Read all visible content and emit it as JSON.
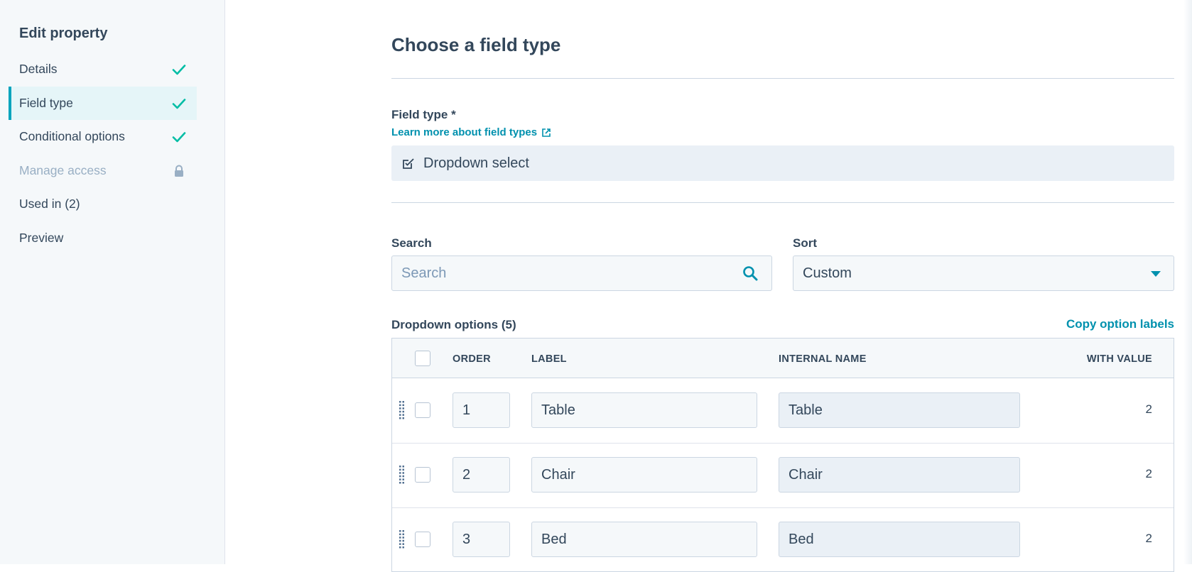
{
  "sidebar": {
    "title": "Edit property",
    "items": [
      {
        "label": "Details",
        "status_icon": "check-icon"
      },
      {
        "label": "Field type",
        "status_icon": "check-icon",
        "active": true
      },
      {
        "label": "Conditional options",
        "status_icon": "check-icon"
      },
      {
        "label": "Manage access",
        "status_icon": "lock-icon",
        "disabled": true
      },
      {
        "label": "Used in (2)"
      },
      {
        "label": "Preview"
      }
    ]
  },
  "main": {
    "title": "Choose a field type",
    "field_type": {
      "label": "Field type *",
      "learn_more_link": "Learn more about field types",
      "selected": "Dropdown select",
      "selected_icon": "checkbox-edit-icon"
    },
    "search": {
      "label": "Search",
      "placeholder": "Search"
    },
    "sort": {
      "label": "Sort",
      "value": "Custom"
    },
    "options": {
      "title": "Dropdown options (5)",
      "copy_link": "Copy option labels",
      "columns": {
        "order": "ORDER",
        "label": "LABEL",
        "internal_name": "INTERNAL NAME",
        "with_value": "WITH VALUE"
      },
      "rows": [
        {
          "order": "1",
          "label": "Table",
          "internal_name": "Table",
          "with_value": "2"
        },
        {
          "order": "2",
          "label": "Chair",
          "internal_name": "Chair",
          "with_value": "2"
        },
        {
          "order": "3",
          "label": "Bed",
          "internal_name": "Bed",
          "with_value": "2"
        }
      ]
    }
  },
  "colors": {
    "accent": "#00a4bd",
    "link": "#0091ae",
    "check": "#00bda5",
    "text": "#33475b"
  }
}
